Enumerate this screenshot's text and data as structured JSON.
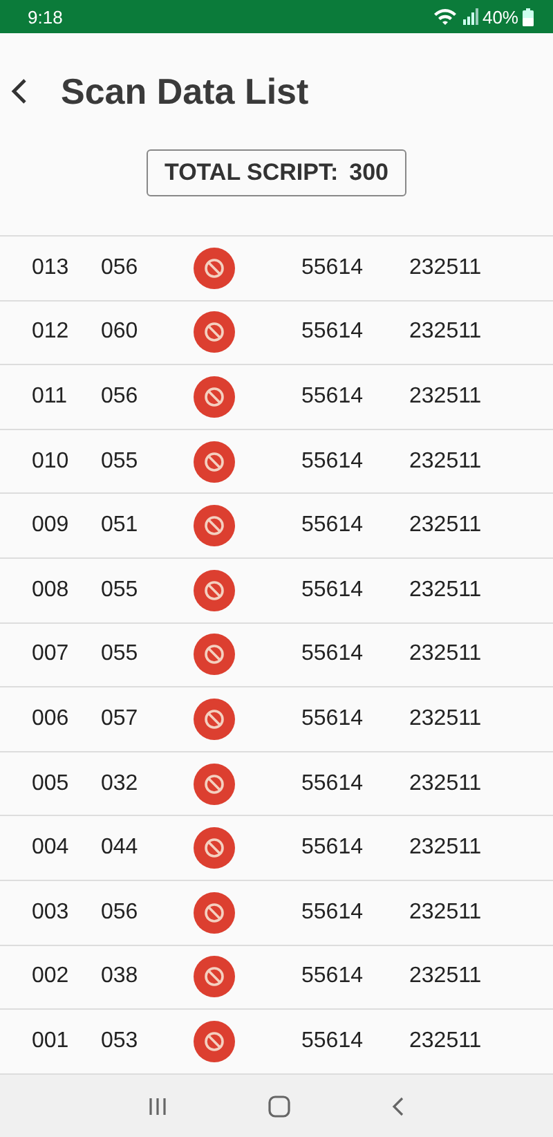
{
  "status_bar": {
    "time": "9:18",
    "battery": "40%"
  },
  "app_bar": {
    "title": "Scan Data List"
  },
  "total": {
    "label": "TOTAL SCRIPT:",
    "value": "300"
  },
  "rows": [
    {
      "column_1": "013",
      "column_2": "056",
      "kind": "blocked",
      "column_4": "55614",
      "column_5": "232511"
    },
    {
      "column_1": "012",
      "column_2": "060",
      "kind": "blocked",
      "column_4": "55614",
      "column_5": "232511"
    },
    {
      "column_1": "011",
      "column_2": "056",
      "kind": "blocked",
      "column_4": "55614",
      "column_5": "232511"
    },
    {
      "column_1": "010",
      "column_2": "055",
      "kind": "blocked",
      "column_4": "55614",
      "column_5": "232511"
    },
    {
      "column_1": "009",
      "column_2": "051",
      "kind": "blocked",
      "column_4": "55614",
      "column_5": "232511"
    },
    {
      "column_1": "008",
      "column_2": "055",
      "kind": "blocked",
      "column_4": "55614",
      "column_5": "232511"
    },
    {
      "column_1": "007",
      "column_2": "055",
      "kind": "blocked",
      "column_4": "55614",
      "column_5": "232511"
    },
    {
      "column_1": "006",
      "column_2": "057",
      "kind": "blocked",
      "column_4": "55614",
      "column_5": "232511"
    },
    {
      "column_1": "005",
      "column_2": "032",
      "kind": "blocked",
      "column_4": "55614",
      "column_5": "232511"
    },
    {
      "column_1": "004",
      "column_2": "044",
      "kind": "blocked",
      "column_4": "55614",
      "column_5": "232511"
    },
    {
      "column_1": "003",
      "column_2": "056",
      "kind": "blocked",
      "column_4": "55614",
      "column_5": "232511"
    },
    {
      "column_1": "002",
      "column_2": "038",
      "kind": "blocked",
      "column_4": "55614",
      "column_5": "232511"
    },
    {
      "column_1": "001",
      "column_2": "053",
      "kind": "blocked",
      "column_4": "55614",
      "column_5": "232511"
    }
  ]
}
